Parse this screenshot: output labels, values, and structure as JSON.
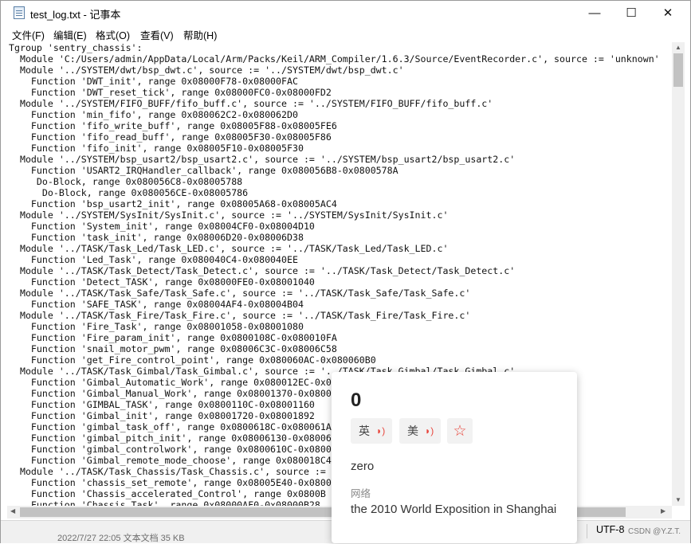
{
  "window": {
    "title": "test_log.txt - 记事本",
    "controls": {
      "minimize": "—",
      "maximize": "☐",
      "close": "✕"
    }
  },
  "menu": [
    "文件(F)",
    "编辑(E)",
    "格式(O)",
    "查看(V)",
    "帮助(H)"
  ],
  "editor_lines": [
    "Tgroup 'sentry_chassis':",
    "  Module 'C:/Users/admin/AppData/Local/Arm/Packs/Keil/ARM_Compiler/1.6.3/Source/EventRecorder.c', source := 'unknown'",
    "  Module '../SYSTEM/dwt/bsp_dwt.c', source := '../SYSTEM/dwt/bsp_dwt.c'",
    "    Function 'DWT_init', range 0x08000F78-0x08000FAC",
    "    Function 'DWT_reset_tick', range 0x08000FC0-0x08000FD2",
    "  Module '../SYSTEM/FIFO_BUFF/fifo_buff.c', source := '../SYSTEM/FIFO_BUFF/fifo_buff.c'",
    "    Function 'min_fifo', range 0x080062C2-0x080062D0",
    "    Function 'fifo_write_buff', range 0x08005F88-0x08005FE6",
    "    Function 'fifo_read_buff', range 0x08005F30-0x08005F86",
    "    Function 'fifo_init', range 0x08005F10-0x08005F30",
    "  Module '../SYSTEM/bsp_usart2/bsp_usart2.c', source := '../SYSTEM/bsp_usart2/bsp_usart2.c'",
    "    Function 'USART2_IRQHandler_callback', range 0x080056B8-0x0800578A",
    "     Do-Block, range 0x080056C8-0x08005788",
    "      Do-Block, range 0x080056CE-0x08005786",
    "    Function 'bsp_usart2_init', range 0x08005A68-0x08005AC4",
    "  Module '../SYSTEM/SysInit/SysInit.c', source := '../SYSTEM/SysInit/SysInit.c'",
    "    Function 'System_init', range 0x08004CF0-0x08004D10",
    "    Function 'task_init', range 0x08006D20-0x08006D38",
    "  Module '../TASK/Task_Led/Task_LED.c', source := '../TASK/Task_Led/Task_LED.c'",
    "    Function 'Led_Task', range 0x080040C4-0x080040EE",
    "  Module '../TASK/Task_Detect/Task_Detect.c', source := '../TASK/Task_Detect/Task_Detect.c'",
    "    Function 'Detect_TASK', range 0x08000FE0-0x08001040",
    "  Module '../TASK/Task_Safe/Task_Safe.c', source := '../TASK/Task_Safe/Task_Safe.c'",
    "    Function 'SAFE_TASK', range 0x08004AF4-0x08004B04",
    "  Module '../TASK/Task_Fire/Task_Fire.c', source := '../TASK/Task_Fire/Task_Fire.c'",
    "    Function 'Fire_Task', range 0x08001058-0x08001080",
    "    Function 'Fire_param_init', range 0x0800108C-0x080010FA",
    "    Function 'snail_motor_pwm', range 0x08006C3C-0x08006C58",
    "    Function 'get_Fire_control_point', range 0x080060AC-0x080060B0",
    "  Module '../TASK/Task_Gimbal/Task_Gimbal.c', source := '../TASK/Task_Gimbal/Task_Gimbal.c'",
    "    Function 'Gimbal_Automatic_Work', range 0x080012EC-0x0800",
    "    Function 'Gimbal_Manual_Work', range 0x08001370-0x0800",
    "    Function 'GIMBAL_TASK', range 0x0800110C-0x08001160",
    "    Function 'Gimbal_init', range 0x08001720-0x08001892",
    "    Function 'gimbal_task_off', range 0x0800618C-0x080061A",
    "    Function 'gimbal_pitch_init', range 0x08006130-0x08006",
    "    Function 'gimbal_controlwork', range 0x0800610C-0x0800",
    "    Function 'Gimbal_remote_mode_choose', range 0x080018C4",
    "  Module '../TASK/Task_Chassis/Task_Chassis.c', source :=",
    "    Function 'chassis_set_remote', range 0x08005E40-0x0800",
    "    Function 'Chassis_accelerated_Control', range 0x0800B",
    "    Function 'Chassis_Task', range 0x08000AF0-0x08000B28"
  ],
  "status": {
    "encoding": "UTF-8"
  },
  "behind_text": "2022/7/27 22:05          文本文档                35 KB",
  "watermark": "CSDN @Y.Z.T.",
  "popup": {
    "word": "0",
    "pron_uk": "英",
    "pron_us": "美",
    "speaker": "◗)",
    "star": "☆",
    "definition": "zero",
    "section_label": "网络",
    "network_definition": "the 2010 World Exposition in Shanghai"
  },
  "scroll": {
    "up": "▲",
    "down": "▼",
    "left": "◀",
    "right": "▶"
  }
}
